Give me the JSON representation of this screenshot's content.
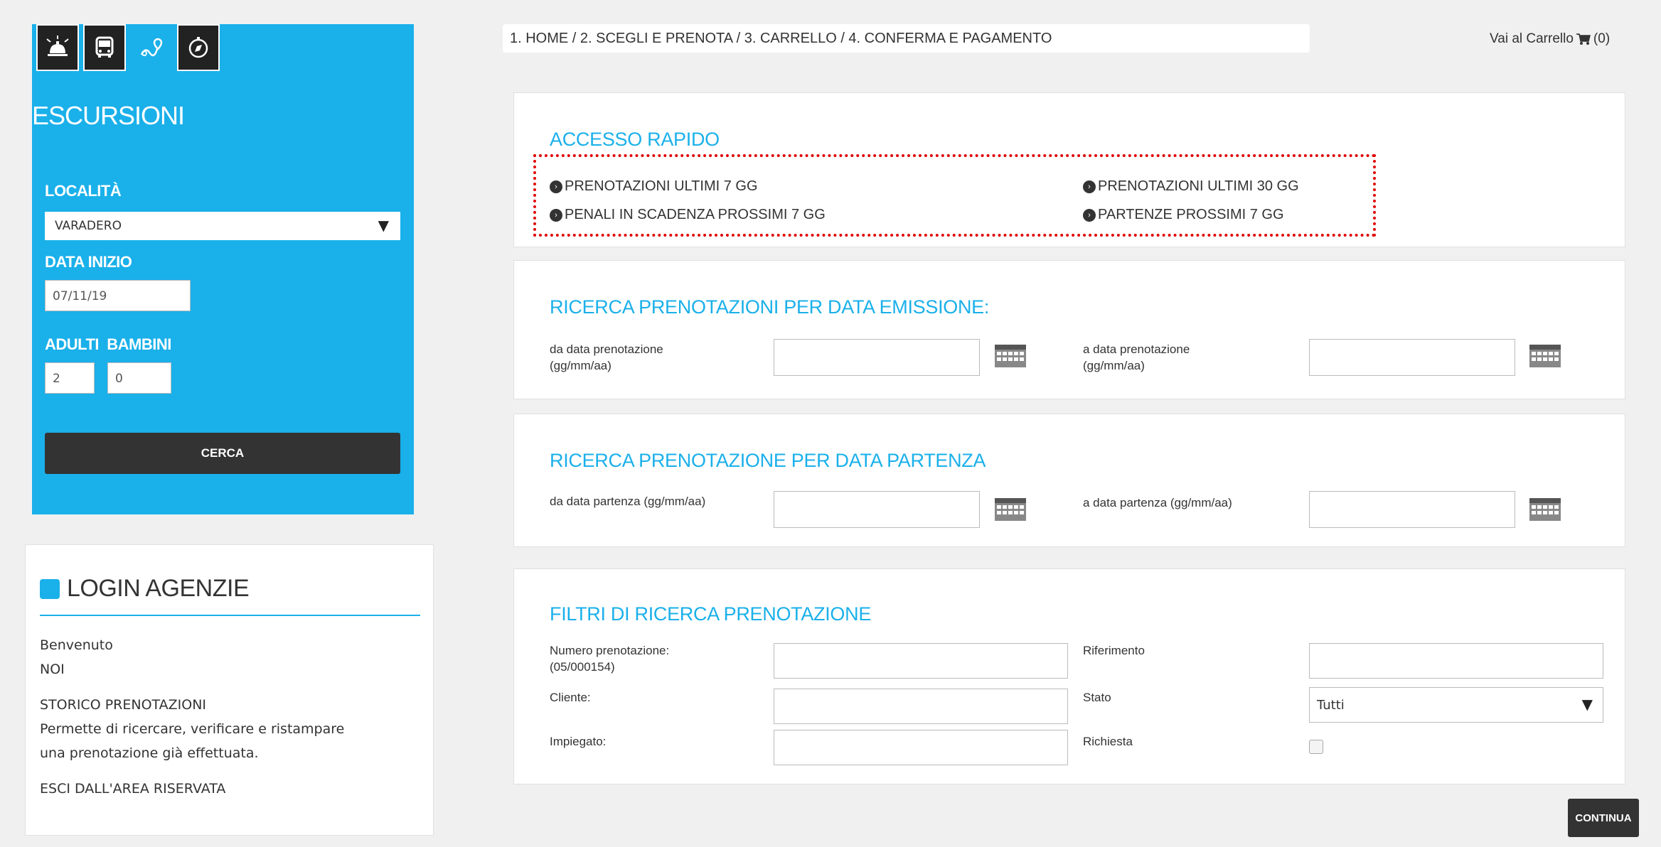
{
  "search_panel": {
    "tabs": [
      {
        "icon": "concierge-bell-icon"
      },
      {
        "icon": "bus-icon"
      },
      {
        "icon": "map-route-icon"
      },
      {
        "icon": "compass-icon"
      }
    ],
    "title": "ESCURSIONI",
    "location_label": "LOCALITÀ",
    "location_value": "VARADERO",
    "date_label": "DATA INIZIO",
    "date_value": "07/11/19",
    "pax_label": "ADULTI  BAMBINI",
    "adults_value": "2",
    "children_value": "0",
    "search_button": "CERCA"
  },
  "login": {
    "title": "LOGIN AGENZIE",
    "welcome": "Benvenuto",
    "user": "NOI",
    "history_title": "STORICO PRENOTAZIONI",
    "history_desc_1": "Permette di ricercare, verificare e ristampare",
    "history_desc_2": "una prenotazione già effettuata.",
    "logout": "ESCI DALL'AREA RISERVATA"
  },
  "header": {
    "breadcrumb": "1. HOME / 2. SCEGLI E PRENOTA / 3. CARRELLO / 4. CONFERMA E PAGAMENTO",
    "cart_label": "Vai al Carrello",
    "cart_count": "(0)"
  },
  "quick_access": {
    "title": "ACCESSO RAPIDO",
    "links": [
      "PRENOTAZIONI ULTIMI 7 GG",
      "PRENOTAZIONI ULTIMI 30 GG",
      "PENALI IN SCADENZA PROSSIMI 7 GG",
      "PARTENZE PROSSIMI 7 GG"
    ]
  },
  "search_by_issue": {
    "title": "RICERCA PRENOTAZIONI PER DATA EMISSIONE:",
    "from_label_1": "da data prenotazione",
    "from_label_2": "(gg/mm/aa)",
    "to_label_1": "a data prenotazione",
    "to_label_2": "(gg/mm/aa)"
  },
  "search_by_departure": {
    "title": "RICERCA PRENOTAZIONE PER DATA PARTENZA",
    "from_label": "da data partenza (gg/mm/aa)",
    "to_label": "a data partenza (gg/mm/aa)"
  },
  "filters": {
    "title": "FILTRI DI RICERCA PRENOTAZIONE",
    "number_label_1": "Numero prenotazione:",
    "number_label_2": "(05/000154)",
    "client_label": "Cliente:",
    "employee_label": "Impiegato:",
    "reference_label": "Riferimento",
    "status_label": "Stato",
    "status_value": "Tutti",
    "request_label": "Richiesta"
  },
  "continue_button": "CONTINUA",
  "colors": {
    "accent": "#1ab0ea",
    "dark": "#333333",
    "highlight": "#e00000"
  }
}
